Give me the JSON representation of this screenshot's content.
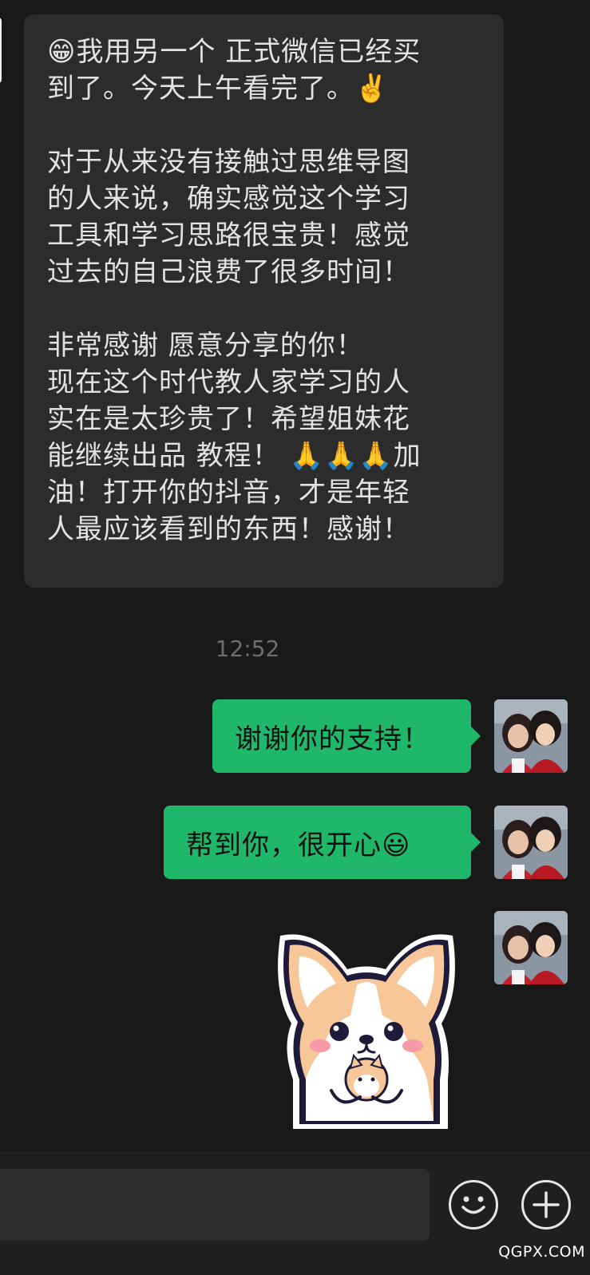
{
  "incoming_message": {
    "paragraphs": [
      [
        "😁我用另一个 正式微信已经买",
        "到了。今天上午看完了。✌️"
      ],
      [
        "对于从来没有接触过思维导图",
        "的人来说，确实感觉这个学习",
        "工具和学习思路很宝贵！感觉",
        "过去的自己浪费了很多时间！"
      ],
      [
        "非常感谢 愿意分享的你！",
        "现在这个时代教人家学习的人",
        "实在是太珍贵了！希望姐妹花",
        "能继续出品 教程！  🙏🙏🙏加",
        "油！打开你的抖音，才是年轻",
        "人最应该看到的东西！感谢！"
      ]
    ]
  },
  "timestamp": "12:52",
  "outgoing_messages": [
    {
      "text": "谢谢你的支持！"
    },
    {
      "text": "帮到你，很开心😃"
    }
  ],
  "sticker": {
    "icon": "corgi-sticker-icon"
  },
  "input_bar": {
    "emoji_icon": "smiley-face-icon",
    "more_icon": "plus-circle-icon"
  },
  "watermark": "QGPX.COM",
  "colors": {
    "background": "#191919",
    "incoming_bubble": "#2c2c2c",
    "outgoing_bubble": "#1fb86a",
    "timestamp": "#6e6e6e"
  }
}
